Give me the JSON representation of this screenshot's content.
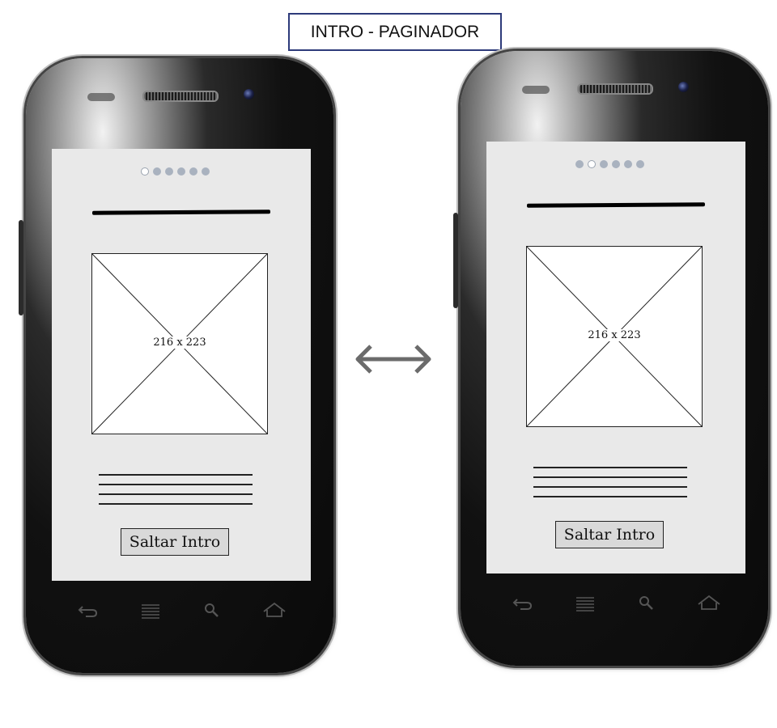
{
  "title": "INTRO - PAGINADOR",
  "screens": [
    {
      "active_page": 1,
      "page_count": 6,
      "image_placeholder": "216 x 223",
      "skip_button": "Saltar Intro"
    },
    {
      "active_page": 2,
      "page_count": 6,
      "image_placeholder": "216 x 223",
      "skip_button": "Saltar Intro"
    }
  ],
  "icons": {
    "transition": "double-arrow-icon",
    "nav": [
      "back-icon",
      "menu-icon",
      "search-icon",
      "home-icon"
    ]
  },
  "colors": {
    "title_border": "#2d3a7a",
    "screen_bg": "#e9e9e9",
    "dot": "#a9b2bf",
    "arrow": "#6b6b6b"
  }
}
